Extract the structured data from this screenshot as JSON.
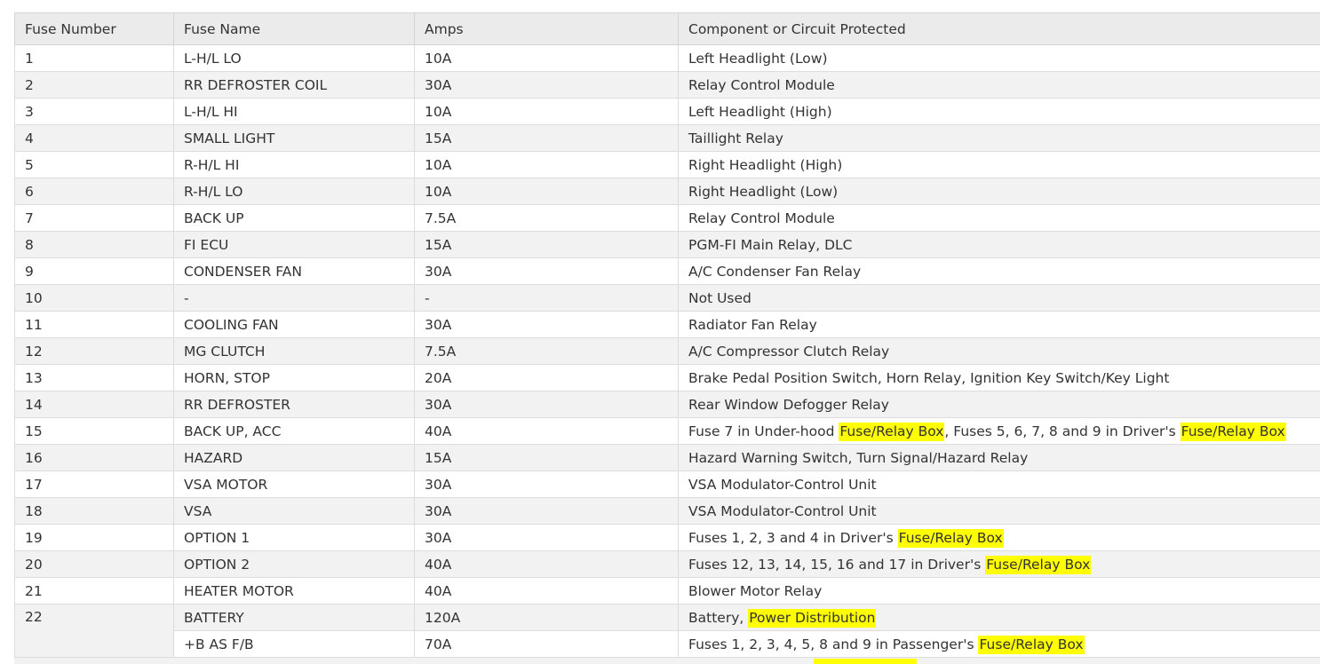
{
  "columns": [
    "Fuse Number",
    "Fuse Name",
    "Amps",
    "Component or Circuit Protected"
  ],
  "rows": [
    {
      "num": "1",
      "name": "L-H/L LO",
      "amps": "10A",
      "component": [
        {
          "t": "Left Headlight (Low)"
        }
      ]
    },
    {
      "num": "2",
      "name": "RR DEFROSTER COIL",
      "amps": "30A",
      "component": [
        {
          "t": "Relay Control Module"
        }
      ]
    },
    {
      "num": "3",
      "name": "L-H/L HI",
      "amps": "10A",
      "component": [
        {
          "t": "Left Headlight (High)"
        }
      ]
    },
    {
      "num": "4",
      "name": "SMALL LIGHT",
      "amps": "15A",
      "component": [
        {
          "t": "Taillight Relay"
        }
      ]
    },
    {
      "num": "5",
      "name": "R-H/L HI",
      "amps": "10A",
      "component": [
        {
          "t": "Right Headlight (High)"
        }
      ]
    },
    {
      "num": "6",
      "name": "R-H/L LO",
      "amps": "10A",
      "component": [
        {
          "t": "Right Headlight (Low)"
        }
      ]
    },
    {
      "num": "7",
      "name": "BACK UP",
      "amps": "7.5A",
      "component": [
        {
          "t": "Relay Control Module"
        }
      ]
    },
    {
      "num": "8",
      "name": "FI ECU",
      "amps": "15A",
      "component": [
        {
          "t": "PGM-FI Main Relay, DLC"
        }
      ]
    },
    {
      "num": "9",
      "name": "CONDENSER FAN",
      "amps": "30A",
      "component": [
        {
          "t": "A/C Condenser Fan Relay"
        }
      ]
    },
    {
      "num": "10",
      "name": "-",
      "amps": "-",
      "component": [
        {
          "t": "Not Used"
        }
      ]
    },
    {
      "num": "11",
      "name": "COOLING FAN",
      "amps": "30A",
      "component": [
        {
          "t": "Radiator Fan Relay"
        }
      ]
    },
    {
      "num": "12",
      "name": "MG CLUTCH",
      "amps": "7.5A",
      "component": [
        {
          "t": "A/C Compressor Clutch Relay"
        }
      ]
    },
    {
      "num": "13",
      "name": "HORN, STOP",
      "amps": "20A",
      "component": [
        {
          "t": "Brake Pedal Position Switch, Horn Relay, Ignition Key Switch/Key Light"
        }
      ]
    },
    {
      "num": "14",
      "name": "RR DEFROSTER",
      "amps": "30A",
      "component": [
        {
          "t": "Rear Window Defogger Relay"
        }
      ]
    },
    {
      "num": "15",
      "name": "BACK UP, ACC",
      "amps": "40A",
      "component": [
        {
          "t": "Fuse 7 in Under-hood "
        },
        {
          "t": "Fuse/Relay Box",
          "hl": true
        },
        {
          "t": ", Fuses 5, 6, 7, 8 and 9 in Driver's "
        },
        {
          "t": "Fuse/Relay Box",
          "hl": true
        }
      ]
    },
    {
      "num": "16",
      "name": "HAZARD",
      "amps": "15A",
      "component": [
        {
          "t": "Hazard Warning Switch, Turn Signal/Hazard Relay"
        }
      ]
    },
    {
      "num": "17",
      "name": "VSA MOTOR",
      "amps": "30A",
      "component": [
        {
          "t": "VSA Modulator-Control Unit"
        }
      ]
    },
    {
      "num": "18",
      "name": "VSA",
      "amps": "30A",
      "component": [
        {
          "t": "VSA Modulator-Control Unit"
        }
      ]
    },
    {
      "num": "19",
      "name": "OPTION 1",
      "amps": "30A",
      "component": [
        {
          "t": "Fuses 1, 2, 3 and 4 in Driver's "
        },
        {
          "t": "Fuse/Relay Box",
          "hl": true
        }
      ]
    },
    {
      "num": "20",
      "name": "OPTION 2",
      "amps": "40A",
      "component": [
        {
          "t": "Fuses 12, 13, 14, 15, 16 and 17 in Driver's "
        },
        {
          "t": "Fuse/Relay Box",
          "hl": true
        }
      ]
    },
    {
      "num": "21",
      "name": "HEATER MOTOR",
      "amps": "40A",
      "component": [
        {
          "t": "Blower Motor Relay"
        }
      ]
    },
    {
      "num": "22",
      "rowspan": 2,
      "name": "BATTERY",
      "amps": "120A",
      "component": [
        {
          "t": "Battery, "
        },
        {
          "t": "Power Distribution",
          "hl": true
        }
      ]
    },
    {
      "name": "+B AS F/B",
      "amps": "70A",
      "component": [
        {
          "t": "Fuses 1, 2, 3, 4, 5, 8 and 9 in Passenger's "
        },
        {
          "t": "Fuse/Relay Box",
          "hl": true
        }
      ]
    }
  ],
  "highlight_color": "#ffff00"
}
